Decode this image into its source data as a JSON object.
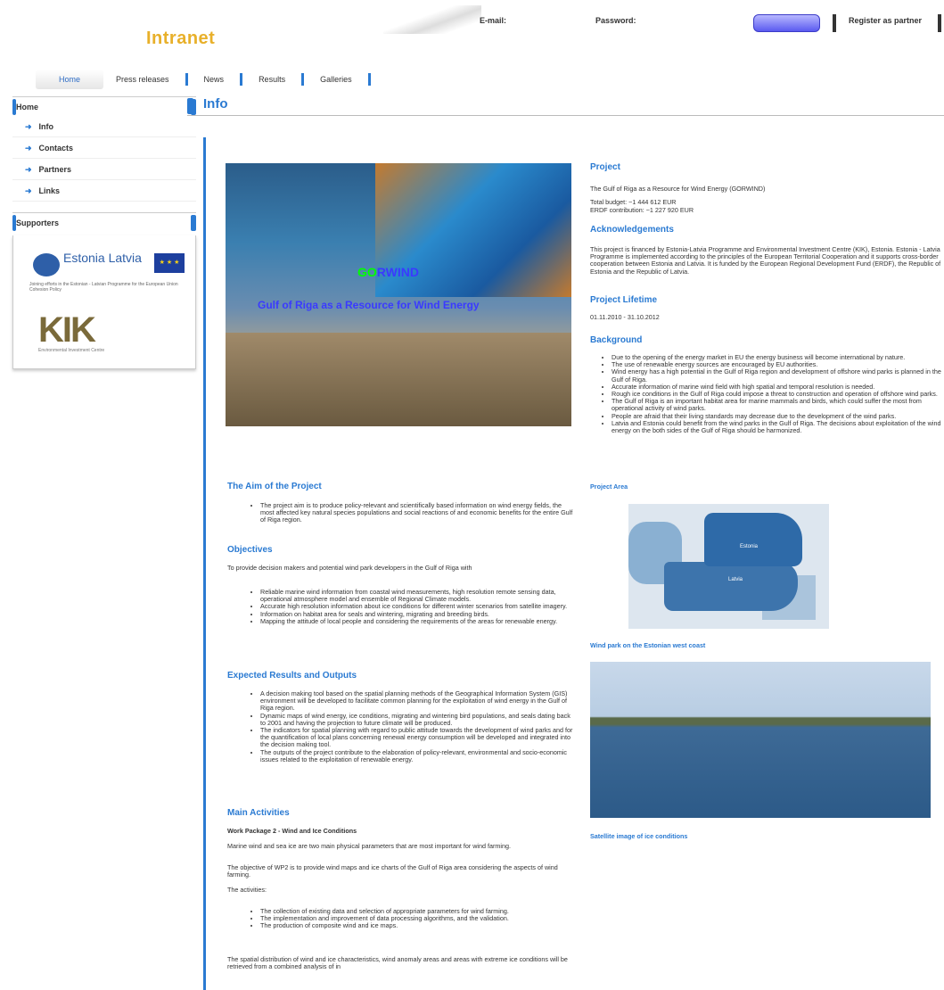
{
  "header": {
    "logo": "Intranet",
    "email_label": "E-mail:",
    "password_label": "Password:",
    "login_button": "",
    "register_link": "Register as partner"
  },
  "nav": [
    "Home",
    "Press releases",
    "News",
    "Results",
    "Galleries"
  ],
  "sidebar": {
    "home_label": "Home",
    "items": [
      "Info",
      "Contacts",
      "Partners",
      "Links"
    ],
    "supporters_label": "Supporters",
    "estonia_latvia": "Estonia Latvia",
    "programme_text": "Joining efforts in the Estonian - Latvian Programme for the European Union Cohesion Policy",
    "kik": "KIK",
    "kik_small": "Environmental Investment Centre"
  },
  "page_title": "Info",
  "hero": {
    "brand_a": "GO",
    "brand_b": "RWIND",
    "subtitle": "Gulf of Riga as a Resource for Wind Energy"
  },
  "project": {
    "heading": "Project",
    "name": "The Gulf of Riga as a Resource for Wind Energy (GORWIND)",
    "budget": "Total budget: ~1 444 612 EUR",
    "erdf": "ERDF contribution: ~1 227 920 EUR"
  },
  "ack": {
    "heading": "Acknowledgements",
    "text": "This project is financed by Estonia-Latvia Programme and Environmental Investment Centre (KIK), Estonia. Estonia - Latvia Programme is implemented according to the principles of the European Territorial Cooperation and it supports cross-border cooperation between Estonia and Latvia. It is funded by the European Regional Development Fund (ERDF), the Republic of Estonia and the Republic of Latvia."
  },
  "lifetime": {
    "heading": "Project Lifetime",
    "dates": "01.11.2010 - 31.10.2012"
  },
  "background": {
    "heading": "Background",
    "items": [
      "Due to the opening of the energy market in EU the energy business will become international by nature.",
      "The use of renewable energy sources are encouraged by EU authorities.",
      "Wind energy has a high potential in the Gulf of Riga region and development of offshore wind parks is planned in the Gulf of Riga.",
      "Accurate information of marine wind field with high spatial and temporal resolution is needed.",
      "Rough ice conditions in the Gulf of Riga could impose a threat to construction and operation of offshore wind parks.",
      "The Gulf of Riga is an important habitat area for marine mammals and birds, which could suffer the most from operational activity of wind parks.",
      "People are afraid that their living standards may decrease due to the development of the wind parks.",
      "Latvia and Estonia could benefit from the wind parks in the Gulf of Riga. The decisions about exploitation of the wind energy on the both sides of the Gulf of Riga should be harmonized."
    ]
  },
  "project_area": {
    "label": "Project Area",
    "estonia": "Estonia",
    "latvia": "Latvia"
  },
  "wind_park_label": "Wind park on the Estonian west coast",
  "satellite_label": "Satellite image of ice conditions",
  "aim": {
    "heading": "The Aim of the Project",
    "items": [
      "The project aim is to produce policy-relevant and scientifically based information on wind energy fields, the most affected key natural species populations and social reactions of and economic benefits for the entire Gulf of Riga region."
    ]
  },
  "objectives": {
    "heading": "Objectives",
    "intro": "To provide decision makers and potential wind park developers in the Gulf of Riga with",
    "items": [
      "Reliable marine wind information from coastal wind measurements, high resolution remote sensing data, operational atmosphere model and ensemble of Regional Climate models.",
      "Accurate high resolution information about ice conditions for different winter scenarios from satellite imagery.",
      "Information on habitat area for seals and wintering, migrating and breeding birds.",
      "Mapping the attitude of local people and considering the requirements of the areas for renewable energy."
    ]
  },
  "results": {
    "heading": "Expected Results and Outputs",
    "items": [
      "A decision making tool based on the spatial planning methods of the Geographical Information System (GIS) environment will be developed to facilitate common planning for the exploitation of wind energy in the Gulf of Riga region.",
      "Dynamic maps of wind energy, ice conditions, migrating and wintering bird populations, and seals dating back to 2001 and having the projection to future climate will be produced.",
      "The indicators for spatial planning with regard to public attitude towards the development of wind parks and for the quantification of local plans concerning renewal energy consumption will be developed and integrated into the decision making tool.",
      "The outputs of the project contribute to the elaboration of policy-relevant, environmental and socio-economic issues related to the exploitation of renewable energy."
    ]
  },
  "activities": {
    "heading": "Main Activities",
    "wp": "Work Package 2 - Wind and Ice Conditions",
    "p1": "Marine wind and sea ice are two main physical parameters that are most important for wind farming.",
    "p2": "The objective of WP2 is to provide wind maps and ice charts of the Gulf of Riga area considering the aspects of wind farming.",
    "p3": "The activities:",
    "items": [
      "The collection of existing data and selection of appropriate parameters for wind farming.",
      "The implementation and improvement of data processing algorithms, and the validation.",
      "The production of composite wind and ice maps."
    ],
    "p4": "The spatial distribution of wind and ice characteristics, wind anomaly areas and areas with extreme ice conditions will be retrieved from a combined analysis of in"
  }
}
